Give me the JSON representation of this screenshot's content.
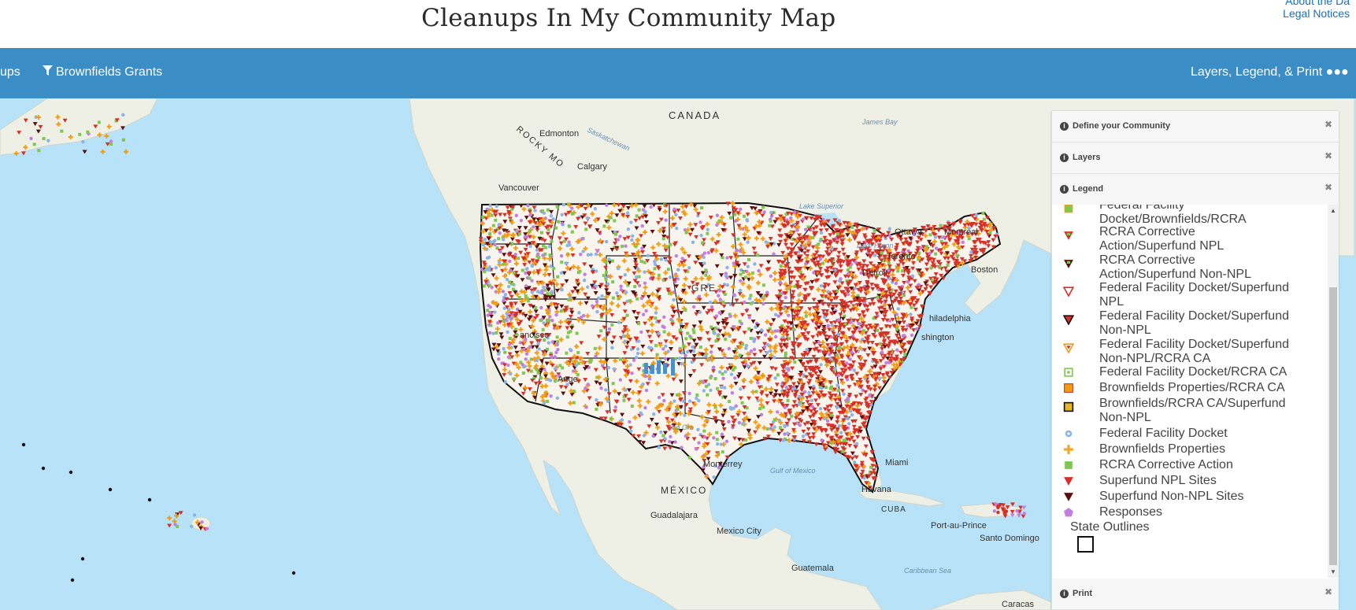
{
  "header": {
    "title": "Cleanups In My Community Map",
    "links": [
      "About the Da",
      "Legal Notices"
    ]
  },
  "navbar": {
    "left_partial": "ups",
    "grants_label": "Brownfields Grants",
    "layers_label": "Layers, Legend, & Print ●●●"
  },
  "map": {
    "labels": {
      "canada": "CANADA",
      "edmonton": "Edmonton",
      "saskatchewan": "Saskatchewan",
      "calgary": "Calgary",
      "vancouver": "Vancouver",
      "rocky": "ROCKY MO",
      "james_bay": "James Bay",
      "lake_superior": "Lake Superior",
      "ottawa": "Ottawa",
      "montreal": "Montreal",
      "lake_huron": "Lake Huron",
      "toronto": "Toronto",
      "detroit": "Detroit",
      "boston": "Boston",
      "philadelphia": "hiladelphia",
      "washington": "shington",
      "great": "GRE",
      "francisco": "ancisco",
      "angeles": "Ange",
      "miami": "Miami",
      "monterrey": "Monterrey",
      "gulf": "Gulf of Mexico",
      "havana": "Havana",
      "cuba": "CUBA",
      "mexico": "MÉXICO",
      "guadalajara": "Guadalajara",
      "mexico_city": "Mexico City",
      "guatemala": "Guatemala",
      "caribbean": "Caribbean Sea",
      "port_au_prince": "Port-au-Prince",
      "santo_domingo": "Santo Domingo",
      "caracas": "Caracas",
      "rio_grande": "Rio Gra"
    }
  },
  "panel": {
    "sections": [
      {
        "label": "Define your Community"
      },
      {
        "label": "Layers"
      },
      {
        "label": "Legend"
      },
      {
        "label": "Print"
      }
    ],
    "legend_items": [
      {
        "label": "Federal Facility Docket/Brownfields/RCRA",
        "lines": [
          "Federal Facility",
          "Docket/Brownfields/RCRA"
        ],
        "symbol": "square-green-orange"
      },
      {
        "label": "RCRA Corrective Action/Superfund NPL",
        "lines": [
          "RCRA Corrective",
          "Action/Superfund NPL"
        ],
        "symbol": "tri-red-green"
      },
      {
        "label": "RCRA Corrective Action/Superfund Non-NPL",
        "lines": [
          "RCRA Corrective",
          "Action/Superfund Non-NPL"
        ],
        "symbol": "tri-dark-green"
      },
      {
        "label": "Federal Facility Docket/Superfund NPL",
        "lines": [
          "Federal Facility Docket/Superfund",
          "NPL"
        ],
        "symbol": "tri-outline-red"
      },
      {
        "label": "Federal Facility Docket/Superfund Non-NPL",
        "lines": [
          "Federal Facility Docket/Superfund",
          "Non-NPL"
        ],
        "symbol": "tri-outline-dark"
      },
      {
        "label": "Federal Facility Docket/Superfund Non-NPL/RCRA CA",
        "lines": [
          "Federal Facility Docket/Superfund",
          "Non-NPL/RCRA CA"
        ],
        "symbol": "tri-outline-orange"
      },
      {
        "label": "Federal Facility Docket/RCRA CA",
        "lines": [
          "Federal Facility Docket/RCRA CA"
        ],
        "symbol": "square-outline-green"
      },
      {
        "label": "Brownfields Properties/RCRA CA",
        "lines": [
          "Brownfields Properties/RCRA CA"
        ],
        "symbol": "square-orange"
      },
      {
        "label": "Brownfields/RCRA CA/Superfund Non-NPL",
        "lines": [
          "Brownfields/RCRA CA/Superfund",
          "Non-NPL"
        ],
        "symbol": "square-gold"
      },
      {
        "label": "Federal Facility Docket",
        "lines": [
          "Federal Facility Docket"
        ],
        "symbol": "circle-blue"
      },
      {
        "label": "Brownfields Properties",
        "lines": [
          "Brownfields Properties"
        ],
        "symbol": "plus-orange"
      },
      {
        "label": "RCRA Corrective Action",
        "lines": [
          "RCRA Corrective Action"
        ],
        "symbol": "square-green"
      },
      {
        "label": "Superfund NPL Sites",
        "lines": [
          "Superfund NPL Sites"
        ],
        "symbol": "tri-red"
      },
      {
        "label": "Superfund Non-NPL Sites",
        "lines": [
          "Superfund Non-NPL Sites"
        ],
        "symbol": "tri-darkred"
      },
      {
        "label": "Responses",
        "lines": [
          "Responses"
        ],
        "symbol": "pentagon-purple"
      }
    ],
    "state_outlines_label": "State Outlines"
  },
  "colors": {
    "navbar": "#3b8dc6",
    "water": "#b7e2f7",
    "land": "#eef0e6",
    "npl": "#d73027",
    "brownfields": "#f39c12",
    "ffd": "#8ab4e8",
    "responses": "#c27ee0",
    "rcra": "#7ec850"
  }
}
